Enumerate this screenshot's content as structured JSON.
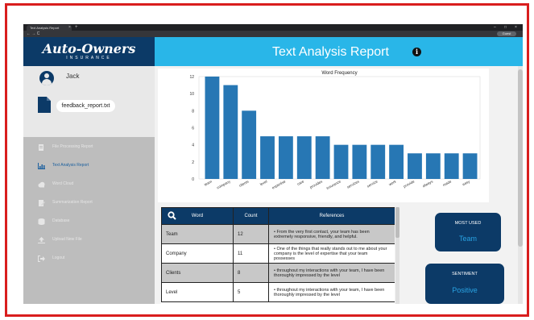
{
  "browser": {
    "tab_title": "Text Analysis Report",
    "tab_close": "×",
    "new_tab": "+",
    "nav_glyphs": "← → C",
    "profile_label": "Guest",
    "window_controls": [
      "–",
      "□",
      "×"
    ]
  },
  "sidebar": {
    "logo": "Auto-Owners",
    "logo_sub": "INSURANCE",
    "username": "Jack",
    "file_name": "feedback_report.txt",
    "nav_items": [
      {
        "label": "File Processing Report",
        "icon": "file-processing-icon",
        "active": false
      },
      {
        "label": "Text Analysis Report",
        "icon": "bar-chart-icon",
        "active": true
      },
      {
        "label": "Word Cloud",
        "icon": "cloud-icon",
        "active": false
      },
      {
        "label": "Summarization Report",
        "icon": "file-edit-icon",
        "active": false
      },
      {
        "label": "Database",
        "icon": "database-icon",
        "active": false
      },
      {
        "label": "Upload New File",
        "icon": "upload-icon",
        "active": false
      },
      {
        "label": "Logout",
        "icon": "logout-icon",
        "active": false
      }
    ]
  },
  "header": {
    "title": "Text Analysis Report",
    "info_glyph": "i"
  },
  "chart_data": {
    "type": "bar",
    "title": "Word Frequency",
    "xlabel": "",
    "ylabel": "",
    "categories": [
      "team",
      "company",
      "clients",
      "level",
      "expertise",
      "care",
      "provides",
      "insurance",
      "services",
      "service",
      "work",
      "provide",
      "always",
      "made",
      "easy"
    ],
    "values": [
      12,
      11,
      8,
      5,
      5,
      5,
      5,
      4,
      4,
      4,
      4,
      3,
      3,
      3,
      3
    ],
    "ylim": [
      0,
      12
    ],
    "yticks": [
      0,
      2,
      4,
      6,
      8,
      10,
      12
    ],
    "grid": false,
    "color": "#2777b4"
  },
  "table": {
    "headers": [
      "Word",
      "Count",
      "References"
    ],
    "rows": [
      {
        "word": "Team",
        "count": "12",
        "refs": "• From the very first contact, your team has been extremely responsive, friendly, and helpful."
      },
      {
        "word": "Company",
        "count": "11",
        "refs": "• One of the things that really stands out to me about your company is the level of expertise that your team possesses"
      },
      {
        "word": "Clients",
        "count": "8",
        "refs": "• throughout my interactions with your team, I have been thoroughly impressed by the level"
      },
      {
        "word": "Level",
        "count": "5",
        "refs": "• throughout my interactions with your team, I have been thoroughly impressed by the level"
      }
    ]
  },
  "cards": {
    "most_used_title": "MOST USED",
    "most_used_value": "Team",
    "sentiment_title": "SENTIMENT",
    "sentiment_value": "Positive"
  },
  "colors": {
    "accent": "#29b6e8",
    "brand": "#0c3a67",
    "bar": "#2777b4",
    "frame": "#d91e1e"
  }
}
